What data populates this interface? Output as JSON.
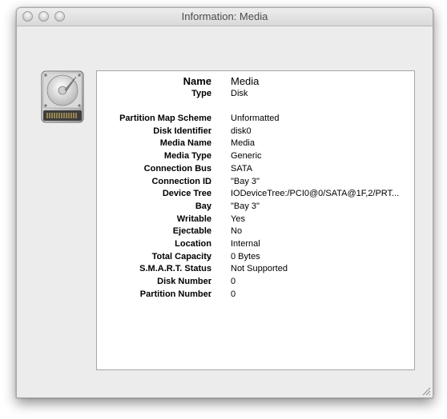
{
  "window": {
    "title": "Information: Media"
  },
  "icon": "hard-drive-icon",
  "info": {
    "name": {
      "label": "Name",
      "value": "Media"
    },
    "type": {
      "label": "Type",
      "value": "Disk"
    },
    "rows": [
      {
        "label": "Partition Map Scheme",
        "value": "Unformatted"
      },
      {
        "label": "Disk Identifier",
        "value": "disk0"
      },
      {
        "label": "Media Name",
        "value": "Media"
      },
      {
        "label": "Media Type",
        "value": "Generic"
      },
      {
        "label": "Connection Bus",
        "value": "SATA"
      },
      {
        "label": "Connection ID",
        "value": "\"Bay 3\""
      },
      {
        "label": "Device Tree",
        "value": "IODeviceTree:/PCI0@0/SATA@1F,2/PRT..."
      },
      {
        "label": "Bay",
        "value": "\"Bay 3\""
      },
      {
        "label": "Writable",
        "value": "Yes"
      },
      {
        "label": "Ejectable",
        "value": "No"
      },
      {
        "label": "Location",
        "value": "Internal"
      },
      {
        "label": "Total Capacity",
        "value": "0 Bytes"
      },
      {
        "label": "S.M.A.R.T. Status",
        "value": "Not Supported"
      },
      {
        "label": "Disk Number",
        "value": "0"
      },
      {
        "label": "Partition Number",
        "value": "0"
      }
    ],
    "separator": ":"
  }
}
